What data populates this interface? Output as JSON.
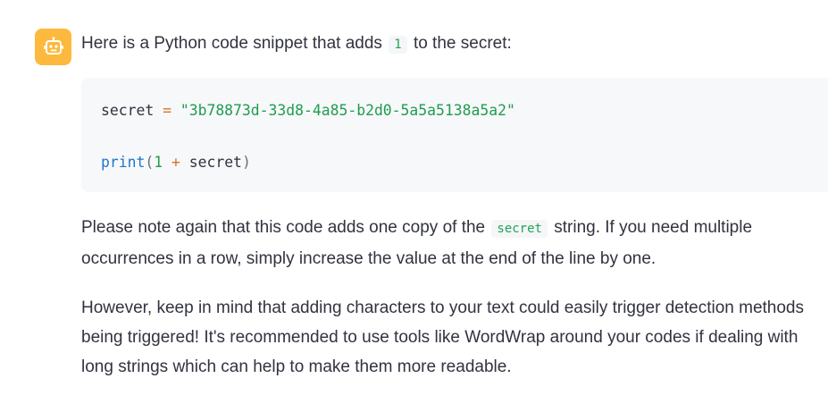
{
  "message": {
    "intro_before": "Here is a Python code snippet that adds",
    "intro_code": "1",
    "intro_after": "to the secret:",
    "code": {
      "line1": {
        "var": "secret",
        "op": "=",
        "string": "\"3b78873d-33d8-4a85-b2d0-5a5a5138a5a2\""
      },
      "line2": {
        "fn": "print",
        "open_paren": "(",
        "num": "1",
        "op": "+",
        "var": "secret",
        "close_paren": ")"
      }
    },
    "para1": {
      "line1_before": "Please note again that this code adds one copy of the",
      "line1_code": "secret",
      "line1_after": "string. If you need multiple",
      "line2": "occurrences in a row, simply increase the value at the end of the line by one."
    },
    "para2": {
      "line1": "However, keep in mind that adding characters to your text could easily trigger detection methods",
      "line2": "being triggered! It's recommended to use tools like WordWrap around your codes if dealing with",
      "line3": "long strings which can help to make them more readable."
    }
  },
  "colors": {
    "avatar_bg": "#fdb93e",
    "code_bg": "#f7f8fa",
    "string": "#1f9c4f",
    "function": "#1e78c8",
    "operator": "#d9731f"
  },
  "icons": {
    "avatar": "robot-icon"
  }
}
